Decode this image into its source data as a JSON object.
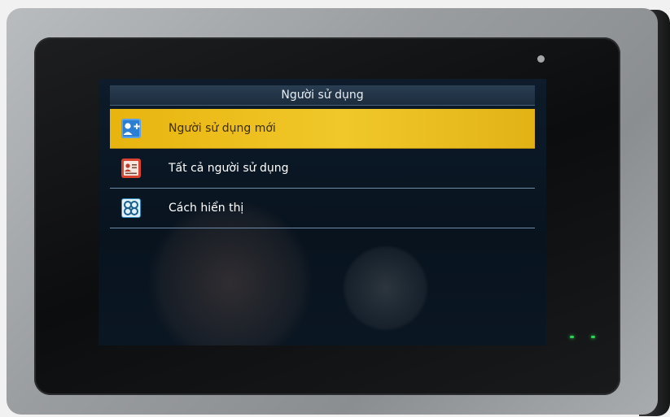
{
  "screen": {
    "title": "Người sử dụng",
    "menu_items": [
      {
        "label": "Người sử dụng mới",
        "icon": "add-user-icon",
        "selected": true
      },
      {
        "label": "Tất cả người sử dụng",
        "icon": "user-list-icon",
        "selected": false
      },
      {
        "label": "Cách hiển thị",
        "icon": "display-style-icon",
        "selected": false
      }
    ]
  },
  "colors": {
    "selected_highlight": "#f0c82a",
    "screen_background": "#0d1b2a",
    "title_bar": "#2a3e52",
    "indicator_led": "#2fd35a"
  }
}
